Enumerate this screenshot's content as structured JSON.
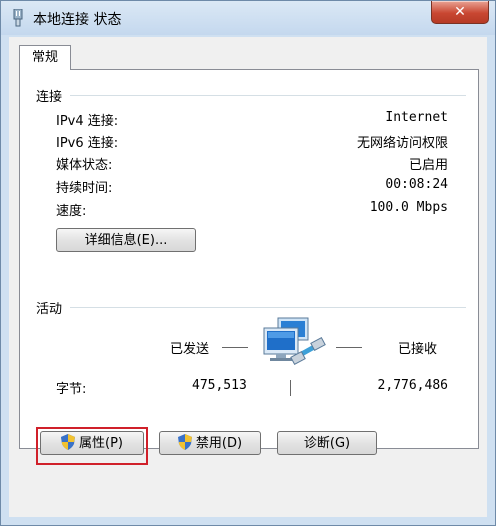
{
  "window": {
    "title": "本地连接 状态",
    "close_glyph": "✕"
  },
  "tabs": [
    {
      "label": "常规"
    }
  ],
  "connection": {
    "group_label": "连接",
    "rows": [
      {
        "label": "IPv4 连接:",
        "value": "Internet"
      },
      {
        "label": "IPv6 连接:",
        "value": "无网络访问权限"
      },
      {
        "label": "媒体状态:",
        "value": "已启用"
      },
      {
        "label": "持续时间:",
        "value": "00:08:24"
      },
      {
        "label": "速度:",
        "value": "100.0 Mbps"
      }
    ],
    "details_button": "详细信息(E)..."
  },
  "activity": {
    "group_label": "活动",
    "sent_label": "已发送",
    "received_label": "已接收",
    "bytes_label": "字节:",
    "bytes_sent": "475,513",
    "bytes_received": "2,776,486"
  },
  "buttons": {
    "properties": "属性(P)",
    "disable": "禁用(D)",
    "diagnose": "诊断(G)"
  },
  "colors": {
    "highlight": "#d0202a",
    "close_button": "#c94732"
  }
}
